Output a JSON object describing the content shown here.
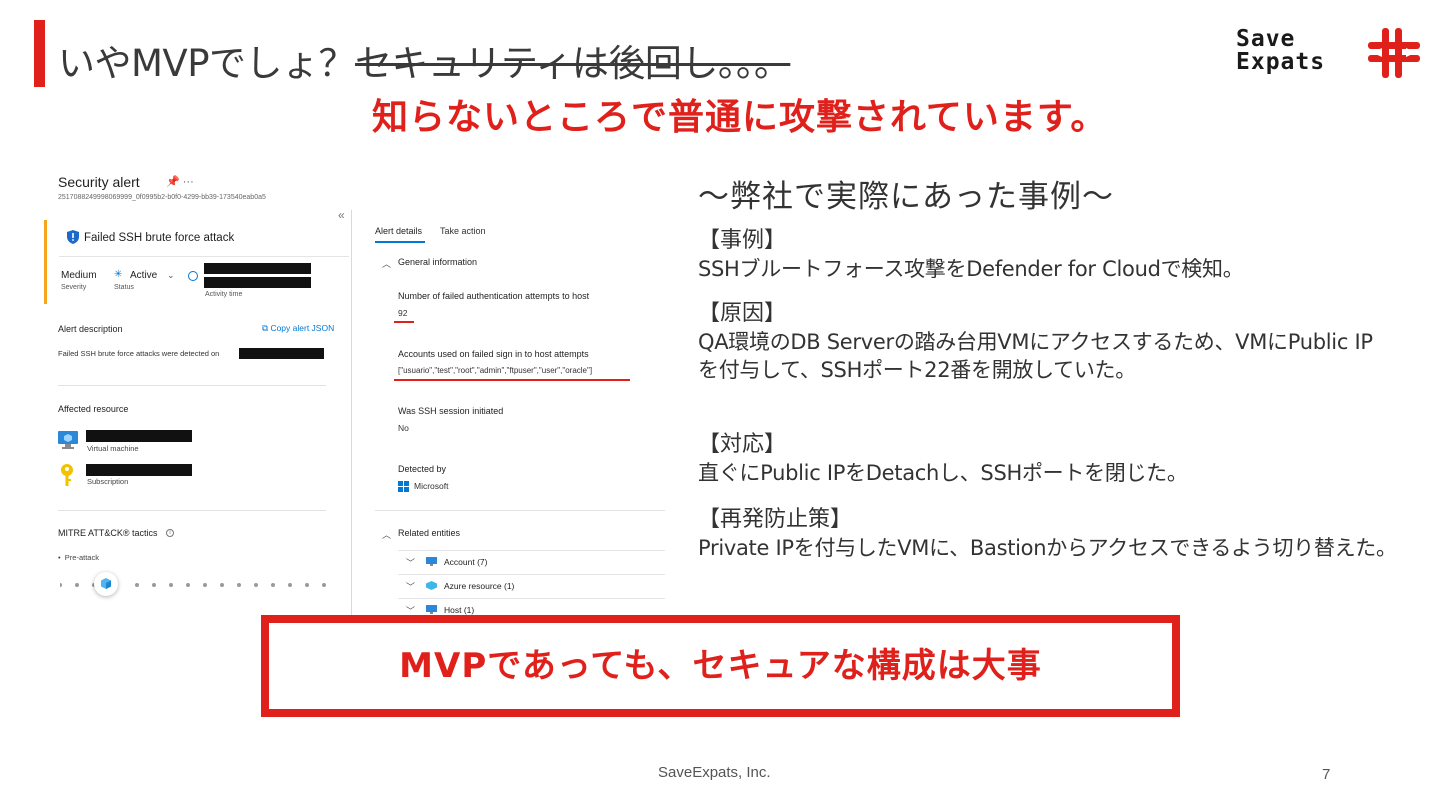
{
  "slide": {
    "title_plain": "いやMVPでしょ？",
    "title_strike": "セキュリティは後回し。。。",
    "subtitle": "知らないところで普通に攻撃されています。",
    "logo_line1": "Save",
    "logo_line2": "Expats",
    "footer": "SaveExpats, Inc.",
    "page_number": "7",
    "accent_color": "#e0201b"
  },
  "screenshot": {
    "header_title": "Security alert",
    "header_ellipsis": "···",
    "alert_id": "2517088249998069999_0f0995b2-b0f0-4299-bb39-173540eab0a5",
    "alert_name": "Failed SSH brute force attack",
    "severity_value": "Medium",
    "severity_label": "Severity",
    "status_value": "Active",
    "status_label": "Status",
    "activity_time_label": "Activity time",
    "alert_description_label": "Alert description",
    "copy_alert_json": "Copy alert JSON",
    "description_text": "Failed SSH brute force attacks were detected on",
    "affected_resource_label": "Affected resource",
    "resource_type_vm": "Virtual machine",
    "resource_type_sub": "Subscription",
    "mitre_label": "MITRE ATT&CK® tactics",
    "mitre_item": "Pre-attack",
    "tabs": [
      "Alert details",
      "Take action"
    ],
    "general_information": "General information",
    "failed_attempts_label": "Number of failed authentication attempts to host",
    "failed_attempts_value": "92",
    "accounts_label": "Accounts used on failed sign in to host attempts",
    "accounts_value": "[\"usuario\",\"test\",\"root\",\"admin\",\"ftpuser\",\"user\",\"oracle\"]",
    "ssh_session_label": "Was SSH session initiated",
    "ssh_session_value": "No",
    "detected_by_label": "Detected by",
    "detected_by_value": "Microsoft",
    "related_entities": "Related entities",
    "entities": [
      "Account (7)",
      "Azure resource (1)",
      "Host (1)"
    ]
  },
  "case_study": {
    "title": "～弊社で実際にあった事例～",
    "sections": [
      {
        "heading": "【事例】",
        "body": "SSHブルートフォース攻撃をDefender for Cloudで検知。"
      },
      {
        "heading": "【原因】",
        "body": "QA環境のDB Serverの踏み台用VMにアクセスするため、VMにPublic IPを付与して、SSHポート22番を開放していた。"
      },
      {
        "heading": "【対応】",
        "body": "直ぐにPublic IPをDetachし、SSHポートを閉じた。"
      },
      {
        "heading": "【再発防止策】",
        "body": "Private IPを付与したVMに、Bastionからアクセスできるよう切り替えた。"
      }
    ]
  },
  "callout": {
    "text": "MVPであっても、セキュアな構成は大事"
  }
}
